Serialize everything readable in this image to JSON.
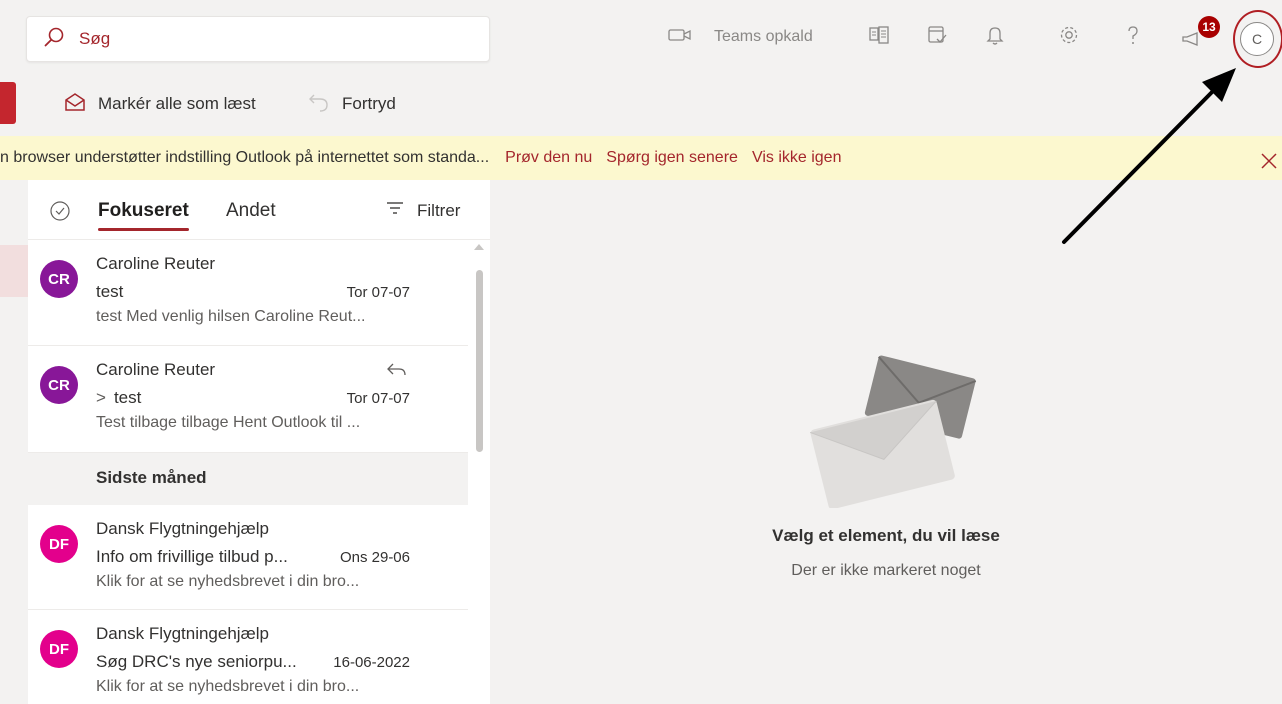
{
  "search": {
    "placeholder": "Søg"
  },
  "header": {
    "teams_call_label": "Teams opkald",
    "notification_badge_count": "13",
    "avatar_initial": "C"
  },
  "commandbar": {
    "mark_all_read_label": "Markér alle som læst",
    "undo_label": "Fortryd"
  },
  "banner": {
    "message": "n browser understøtter indstilling Outlook på internettet som standa...",
    "try_now": "Prøv den nu",
    "ask_later": "Spørg igen senere",
    "dont_show": "Vis ikke igen"
  },
  "list": {
    "tabs": {
      "focused": "Fokuseret",
      "other": "Andet"
    },
    "filter_label": "Filtrer",
    "section_last_month": "Sidste måned",
    "messages": [
      {
        "initials": "CR",
        "avatar_color": "#881798",
        "sender": "Caroline Reuter",
        "subject": "test",
        "date": "Tor 07-07",
        "preview": "test Med venlig hilsen Caroline Reut..."
      },
      {
        "initials": "CR",
        "avatar_color": "#881798",
        "sender": "Caroline Reuter",
        "subject": "test",
        "date": "Tor 07-07",
        "preview": "Test tilbage tilbage Hent Outlook til ...",
        "replied": true,
        "thread_chevron": ">"
      },
      {
        "initials": "DF",
        "avatar_color": "#e3008c",
        "sender": "Dansk Flygtningehjælp",
        "subject": "Info om frivillige tilbud p...",
        "date": "Ons 29-06",
        "preview": "Klik for at se nyhedsbrevet i din bro..."
      },
      {
        "initials": "DF",
        "avatar_color": "#e3008c",
        "sender": "Dansk Flygtningehjælp",
        "subject": "Søg DRC's nye seniorpu...",
        "date": "16-06-2022",
        "preview": "Klik for at se nyhedsbrevet i din bro..."
      }
    ]
  },
  "reading_pane": {
    "empty_title": "Vælg et element, du vil læse",
    "empty_subtitle": "Der er ikke markeret noget"
  },
  "colors": {
    "accent": "#a4262c",
    "banner_bg": "#fcf8cf",
    "annotation": "#b01e23"
  }
}
